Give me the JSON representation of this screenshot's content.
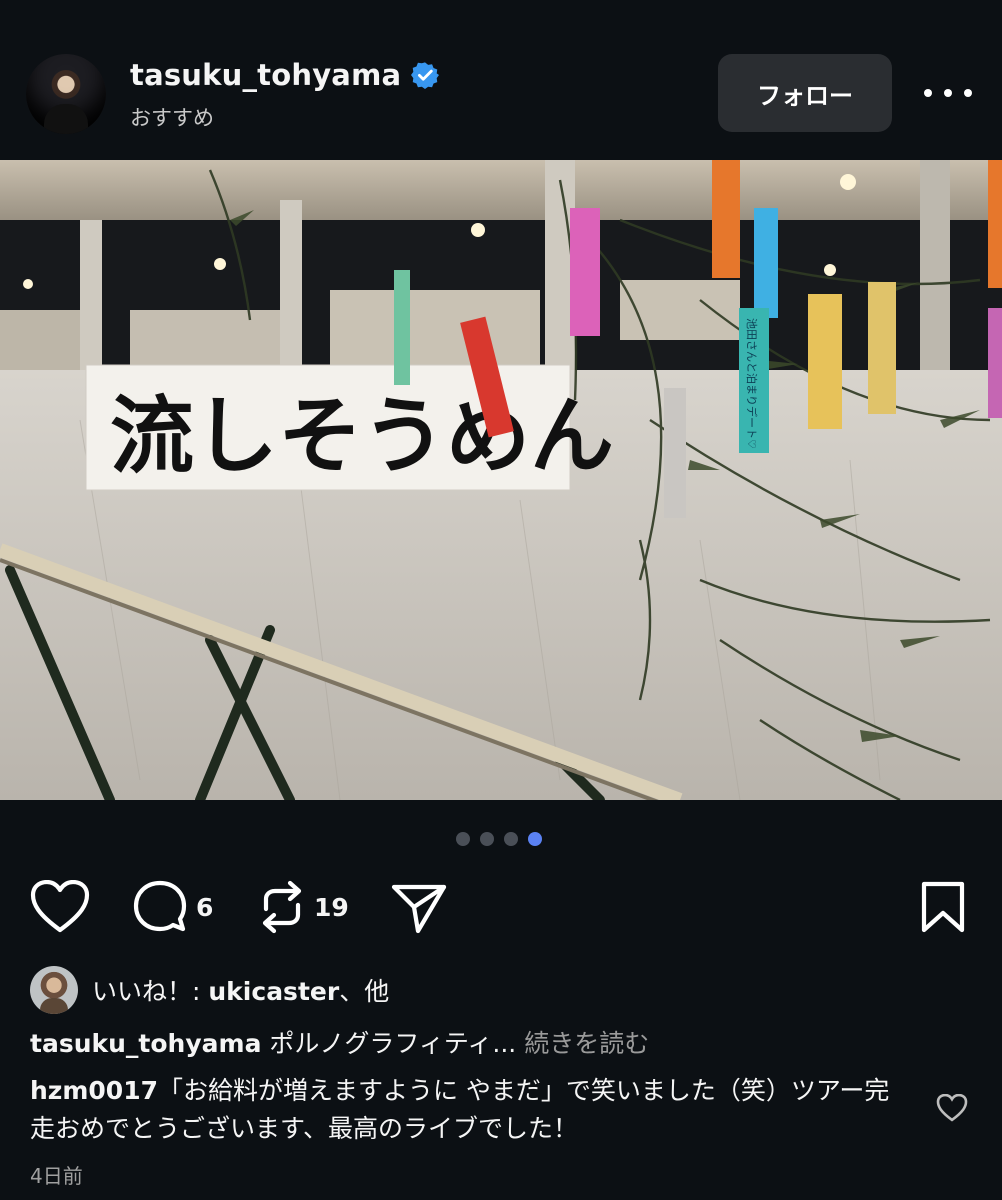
{
  "post": {
    "username": "tasuku_tohyama",
    "subtitle": "おすすめ",
    "follow_label": "フォロー",
    "image": {
      "banner_text": "流しそうめん",
      "tanzaku_text": [
        "池田さんと泊まりデート♡"
      ]
    },
    "carousel": {
      "total": 4,
      "active": 4
    },
    "actions": {
      "comments_count": "6",
      "reposts_count": "19"
    },
    "likes": {
      "prefix": "いいね！: ",
      "user": "ukicaster",
      "suffix": "、他"
    },
    "caption": {
      "username": "tasuku_tohyama",
      "text": " ポルノグラフィティ... ",
      "more": "続きを読む"
    },
    "comment": {
      "username": "hzm0017",
      "text": "「お給料が増えますように やまだ」で笑いました（笑）ツアー完走おめでとうございます、最高のライブでした！"
    },
    "time": "4日前"
  },
  "colors": {
    "background": "#0c1014",
    "verified": "#3897f0",
    "dot_active": "#5b82f3",
    "button": "#2a2d31"
  }
}
